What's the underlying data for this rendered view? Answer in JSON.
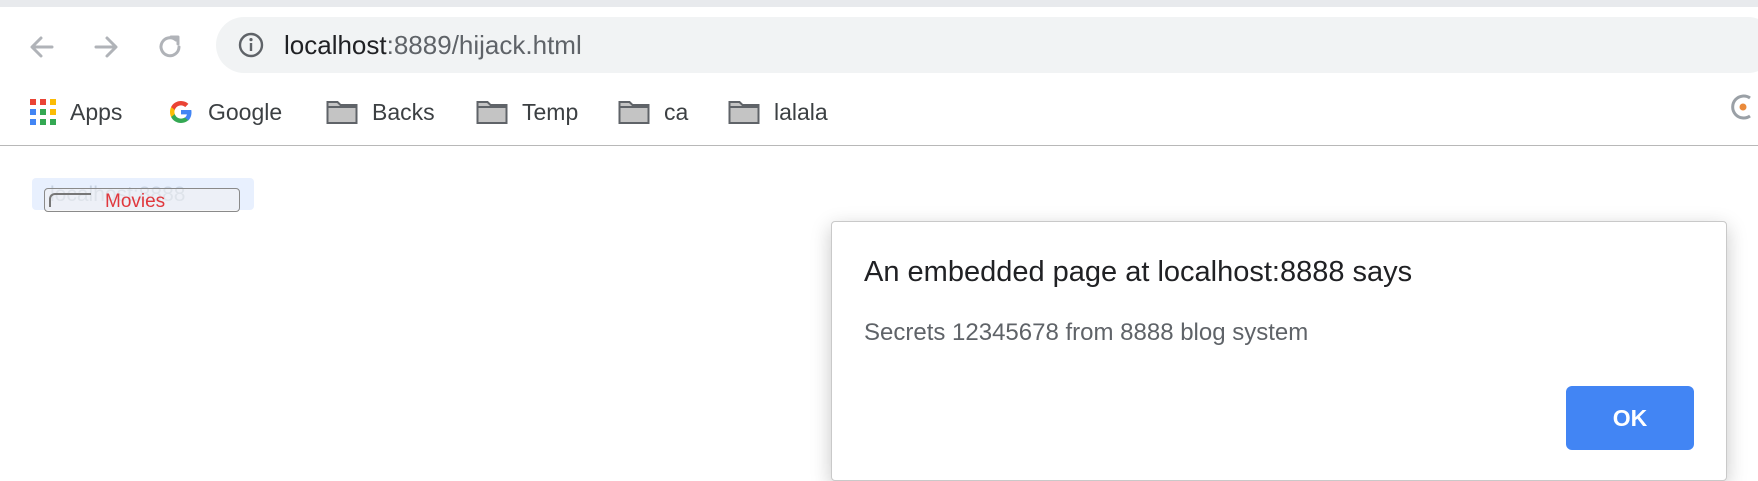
{
  "browser": {
    "url_host": "localhost",
    "url_path": ":8889/hijack.html"
  },
  "bookmarks": [
    {
      "label": "Apps",
      "icon": "apps-grid-icon"
    },
    {
      "label": "Google",
      "icon": "google-logo-icon"
    },
    {
      "label": "Backs",
      "icon": "folder-icon"
    },
    {
      "label": "Temp",
      "icon": "folder-icon"
    },
    {
      "label": "ca",
      "icon": "folder-icon"
    },
    {
      "label": "lalala",
      "icon": "folder-icon"
    }
  ],
  "page": {
    "decoy_ghost_text": "localhost:8888",
    "decoy_button_label": "Movies"
  },
  "dialog": {
    "title": "An embedded page at localhost:8888 says",
    "message": "Secrets 12345678 from 8888 blog system",
    "ok_label": "OK"
  },
  "colors": {
    "accent": "#4285f4",
    "decoy_text": "#e0383e"
  }
}
